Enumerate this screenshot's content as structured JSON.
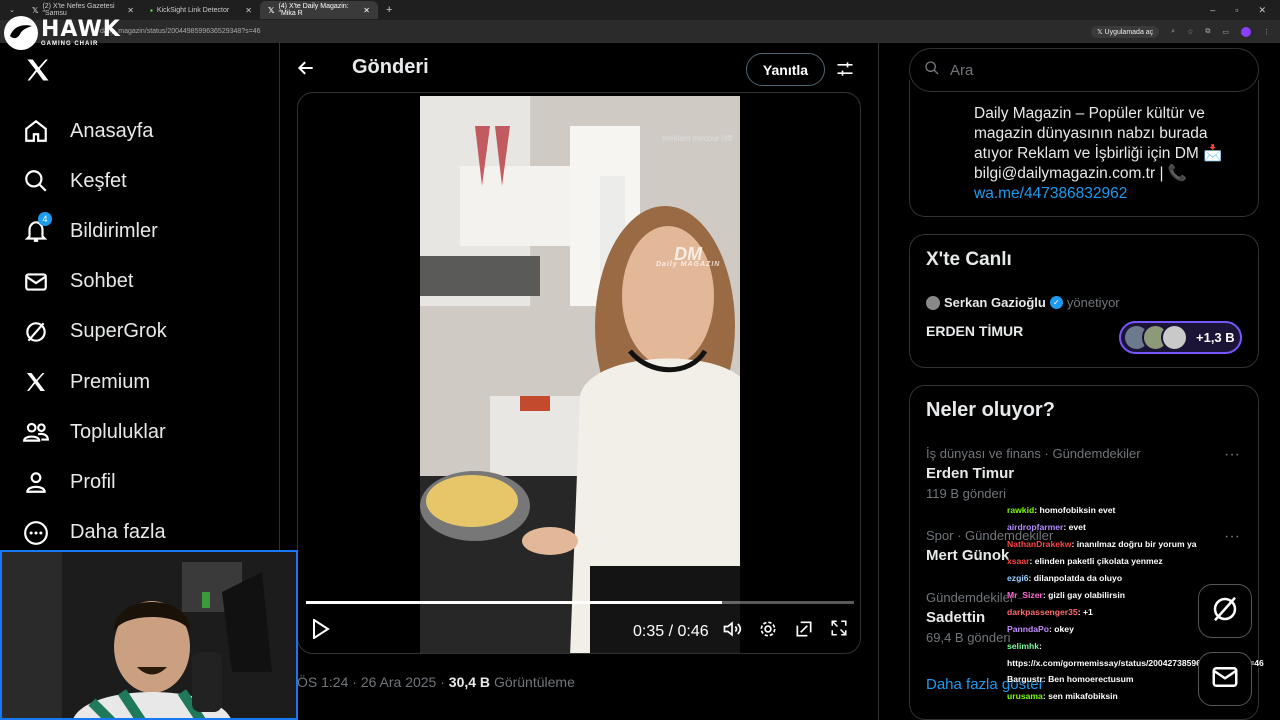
{
  "browser": {
    "tabs": [
      {
        "label": "(2) X'te Nefes Gazetesi \"Samsu",
        "active": false
      },
      {
        "label": "KickSight Link Detector",
        "active": false
      },
      {
        "label": "(4) X'te Daily Magazin: \"Mika R",
        "active": true
      }
    ],
    "new_tab": "+",
    "url": "daily_magazin/status/2004498599636529348?s=46",
    "open_in_app": "Uygulamada aç"
  },
  "overlay_logo": {
    "title": "HAWK",
    "subtitle": "GAMING CHAIR"
  },
  "nav": {
    "items": [
      {
        "label": "Anasayfa",
        "icon": "home-icon"
      },
      {
        "label": "Keşfet",
        "icon": "search-icon"
      },
      {
        "label": "Bildirimler",
        "icon": "bell-icon",
        "badge": "4"
      },
      {
        "label": "Sohbet",
        "icon": "mail-icon"
      },
      {
        "label": "SuperGrok",
        "icon": "grok-icon"
      },
      {
        "label": "Premium",
        "icon": "x-icon"
      },
      {
        "label": "Topluluklar",
        "icon": "people-icon"
      },
      {
        "label": "Profil",
        "icon": "person-icon"
      },
      {
        "label": "Daha fazla",
        "icon": "more-icon"
      }
    ]
  },
  "header": {
    "title": "Gönderi",
    "reply_label": "Yanıtla"
  },
  "video": {
    "watermark": "#reklam mecbur ölff",
    "logo_text": "DM",
    "logo_sub": "Daily MAGAZIN",
    "time": "0:35 / 0:46",
    "progress": 0.76
  },
  "post_meta": {
    "time": "ÖS 1:24",
    "sep": "·",
    "date": "26 Ara 2025",
    "views": "30,4 B",
    "views_label": "Görüntüleme"
  },
  "search": {
    "placeholder": "Ara"
  },
  "bio": {
    "text": "Daily Magazin – Popüler kültür ve magazin dünyasının nabzı burada atıyor Reklam ve İşbirliği için DM 📩 bilgi@dailymagazin.com.tr | 📞",
    "link": "wa.me/447386832962"
  },
  "live": {
    "title": "X'te Canlı",
    "host": "Serkan Gazioğlu",
    "role": "yönetiyor",
    "space_title": "ERDEN TİMUR",
    "listener_count": "+1,3 B"
  },
  "trends": {
    "title": "Neler oluyor?",
    "items": [
      {
        "category": "İş dünyası ve finans · Gündemdekiler",
        "name": "Erden Timur",
        "count": "119 B gönderi"
      },
      {
        "category": "Spor · Gündemdekiler",
        "name": "Mert Günok",
        "count": ""
      },
      {
        "category": "Gündemdekiler",
        "name": "Sadettin",
        "count": "69,4 B gönderi"
      }
    ],
    "show_more": "Daha fazla göster"
  },
  "chat": [
    {
      "user": "rawkid",
      "color": "#7cfc00",
      "msg": ": homofobiksin evet"
    },
    {
      "user": "airdropfarmer",
      "color": "#b58cff",
      "msg": ": evet"
    },
    {
      "user": "NathanDrakekw",
      "color": "#ff4444",
      "msg": ": inanılmaz doğru bir yorum ya"
    },
    {
      "user": "xsaar",
      "color": "#ff4444",
      "msg": ": elinden paketli çikolata yenmez"
    },
    {
      "user": "ezgi6",
      "color": "#9ad0ff",
      "msg": ": dilanpolatda da oluyo"
    },
    {
      "user": "Mr_Sizer",
      "color": "#ff6bd6",
      "msg": ": gizli gay olabilirsin"
    },
    {
      "user": "darkpassenger35",
      "color": "#ff6b6b",
      "msg": ": +1"
    },
    {
      "user": "PanndaPo",
      "color": "#c38cff",
      "msg": ": okey"
    },
    {
      "user": "selimhk",
      "color": "#7cfc9a",
      "msg": ":"
    },
    {
      "user": "",
      "color": "#ffffff",
      "msg": "https://x.com/gormemissay/status/2004273859600781817?s=46"
    },
    {
      "user": "Bargustr",
      "color": "#ffffff",
      "msg": ": Ben homoerectusum"
    },
    {
      "user": "urusama",
      "color": "#7cfc00",
      "msg": ": sen mikafobiksin"
    }
  ],
  "colors": {
    "accent": "#1d9bf0",
    "live_purple": "#7856ff",
    "webcam_border": "#1877f2"
  }
}
